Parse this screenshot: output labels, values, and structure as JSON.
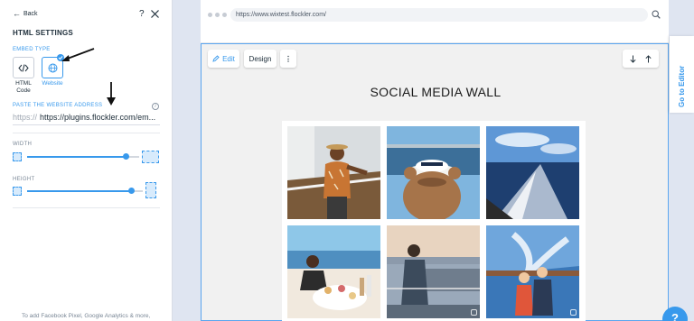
{
  "panel": {
    "back_label": "Back",
    "help_label": "?",
    "title": "HTML SETTINGS",
    "embed_type_label": "EMBED TYPE",
    "embed_options": [
      {
        "label_line1": "HTML",
        "label_line2": "Code",
        "icon": "code-icon",
        "selected": false
      },
      {
        "label_line1": "Website",
        "label_line2": "",
        "icon": "globe-icon",
        "selected": true
      }
    ],
    "address_label": "PASTE THE WEBSITE ADDRESS",
    "url_protocol": "https://",
    "url_value": "https://plugins.flockler.com/em...",
    "width_label": "WIDTH",
    "width_value": 0.88,
    "height_label": "HEIGHT",
    "height_value": 0.9,
    "footnote": "To add Facebook Pixel, Google Analytics & more,"
  },
  "browser": {
    "address": "https://www.wixtest.flockler.com/",
    "toolbar": {
      "edit_label": "Edit",
      "design_label": "Design",
      "more_label": "⋮"
    },
    "wall_title": "SOCIAL MEDIA WALL"
  },
  "side": {
    "goto_editor_label": "Go to Editor",
    "help_label": "?"
  },
  "colors": {
    "accent": "#3899ec",
    "page_bg": "#dfe5f1"
  }
}
